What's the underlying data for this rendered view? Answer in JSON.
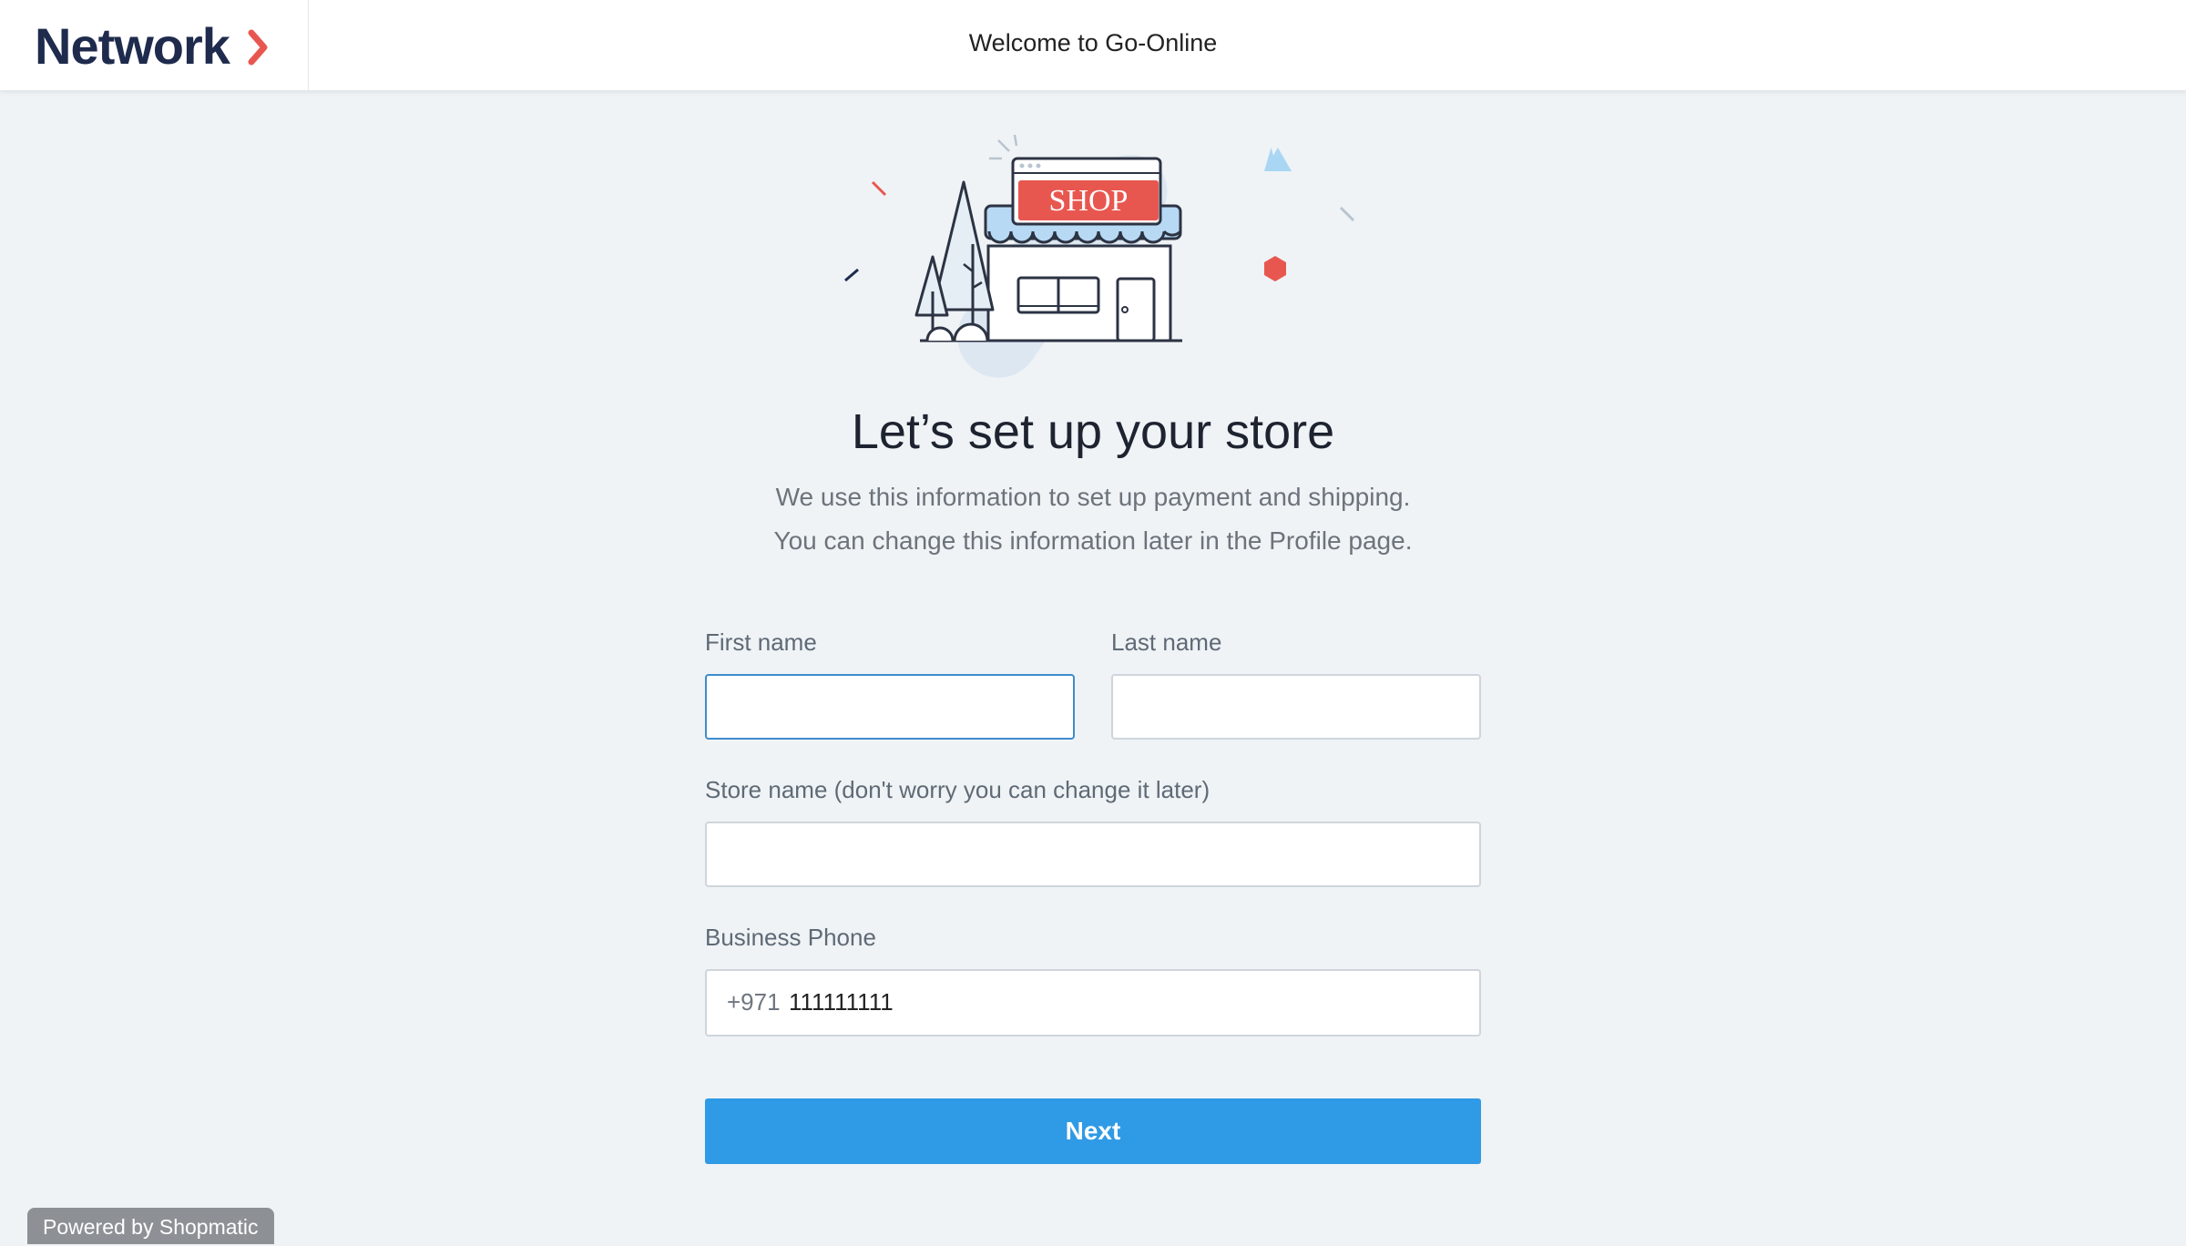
{
  "header": {
    "logo_text": "Network",
    "welcome_text": "Welcome to Go-Online"
  },
  "illustration": {
    "sign_text": "SHOP"
  },
  "main": {
    "title": "Let’s set up your store",
    "subtitle_line1": "We use this information to set up payment and shipping.",
    "subtitle_line2": "You can change this information later in the Profile page."
  },
  "form": {
    "first_name_label": "First name",
    "first_name_value": "",
    "last_name_label": "Last name",
    "last_name_value": "",
    "store_name_label": "Store name (don't worry you can change it later)",
    "store_name_value": "",
    "phone_label": "Business Phone",
    "phone_prefix": "+971",
    "phone_value": "111111111",
    "next_label": "Next"
  },
  "footer": {
    "powered_by": "Powered by Shopmatic"
  },
  "colors": {
    "accent": "#2f9ae5",
    "brand_navy": "#1f2b4d",
    "brand_red": "#e8574f",
    "background": "#eff3f6"
  }
}
